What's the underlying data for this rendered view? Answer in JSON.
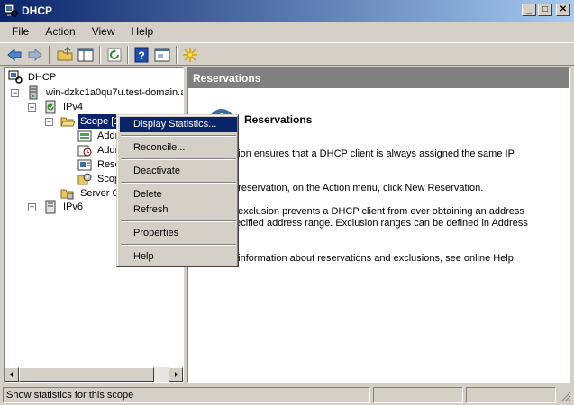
{
  "window": {
    "title": "DHCP",
    "icon": "dhcp-icon"
  },
  "title_buttons": [
    "minimize-icon",
    "maximize-icon",
    "close-icon"
  ],
  "menu": [
    "File",
    "Action",
    "View",
    "Help"
  ],
  "toolbar": {
    "icons": [
      "back-arrow-icon",
      "forward-arrow-icon",
      "up-folder-icon",
      "show-hide-tree-icon",
      "refresh-icon",
      "help-icon",
      "properties-icon",
      "star-icon"
    ]
  },
  "tree": {
    "root": "DHCP",
    "server": "win-dzkc1a0qu7u.test-domain.a",
    "ipv4": "IPv4",
    "scope": "Scope [1",
    "addr_pool": "Addr",
    "addr_leases": "Addr",
    "reservations": "Rese",
    "scope_options": "Scop",
    "server_options": "Server O",
    "ipv6": "IPv6"
  },
  "right_pane": {
    "header": "Reservations",
    "title": "Reservations",
    "para1": "ation ensures that a DHCP client is always assigned the same IP",
    "para2": "a reservation, on the Action menu, click New Reservation.",
    "para3_line1": "n exclusion prevents a DHCP client from ever obtaining an address",
    "para3_line2": "pecified address range.  Exclusion ranges can be defined in Address",
    "para4": "e information about reservations and exclusions, see online Help."
  },
  "context_menu": {
    "display_statistics": "Display Statistics...",
    "reconcile": "Reconcile...",
    "deactivate": "Deactivate",
    "delete": "Delete",
    "refresh": "Refresh",
    "properties": "Properties",
    "help": "Help"
  },
  "status": {
    "text": "Show statistics for this scope"
  }
}
